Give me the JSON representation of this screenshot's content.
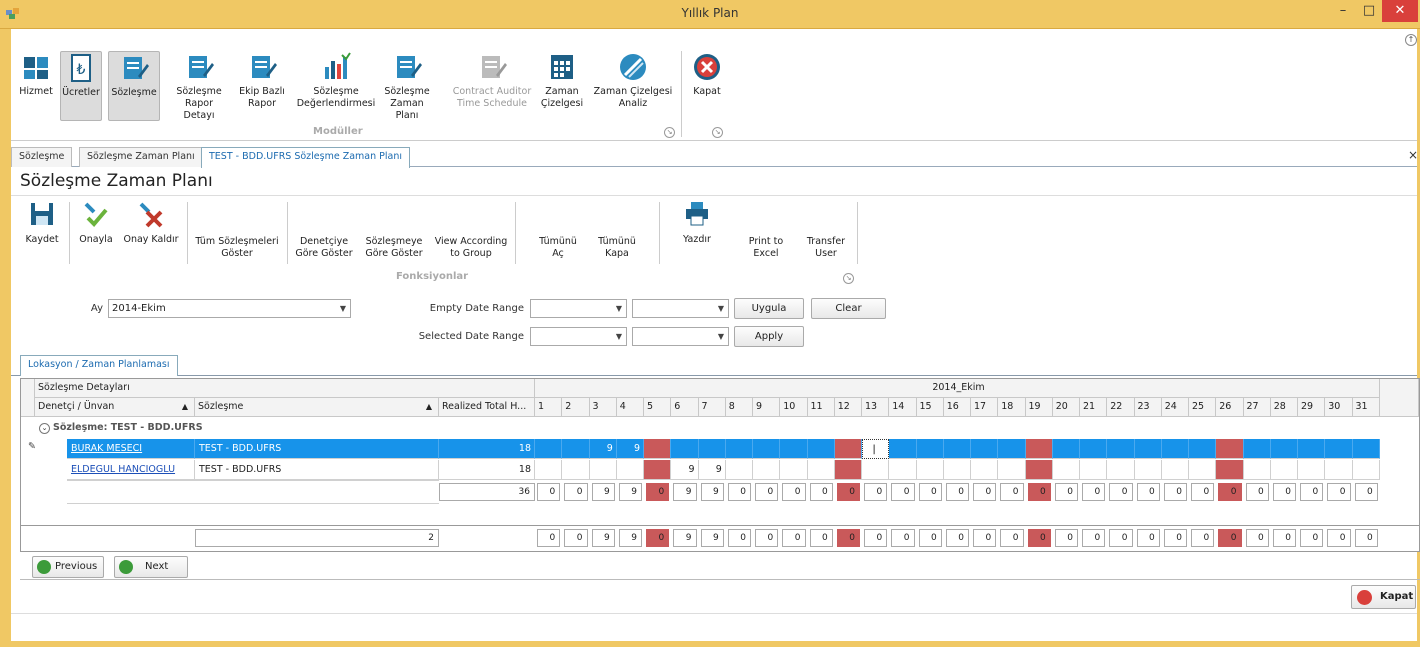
{
  "window": {
    "title": "Yıllık Plan",
    "min": "–",
    "max": "□",
    "close": "✕"
  },
  "ribbon": {
    "items": [
      "Hizmet",
      "Ücretler",
      "Sözleşme",
      "Sözleşme\nRapor Detayı",
      "Ekip Bazlı\nRapor",
      "Sözleşme\nDeğerlendirmesi",
      "Sözleşme\nZaman Planı",
      "Contract Auditor\nTime Schedule",
      "Zaman\nÇizelgesi",
      "Zaman Çizelgesi\nAnaliz",
      "Kapat"
    ],
    "group_label": "Modüller"
  },
  "doc_tabs": [
    "Sözleşme",
    "Sözleşme Zaman Planı",
    "TEST - BDD.UFRS Sözleşme Zaman Planı"
  ],
  "page_title": "Sözleşme Zaman Planı",
  "functions": {
    "items": [
      "Kaydet",
      "Onayla",
      "Onay Kaldır",
      "Tüm Sözleşmeleri\nGöster",
      "Denetçiye\nGöre Göster",
      "Sözleşmeye\nGöre Göster",
      "View According\nto Group",
      "Tümünü Aç",
      "Tümünü\nKapa",
      "Yazdır",
      "Print to\nExcel",
      "Transfer\nUser"
    ],
    "group_label": "Fonksiyonlar"
  },
  "filters": {
    "ay_label": "Ay",
    "ay_value": "2014-Ekim",
    "empty_label": "Empty Date Range",
    "selected_label": "Selected Date Range",
    "uygula": "Uygula",
    "clear": "Clear",
    "apply": "Apply"
  },
  "sub_tab": "Lokasyon / Zaman Planlaması",
  "grid": {
    "band_left": "Sözleşme Detayları",
    "band_right": "2014_Ekim",
    "col_auditor": "Denetçi / Ünvan",
    "col_contract": "Sözleşme",
    "col_total": "Realized Total H...",
    "days": [
      "1",
      "2",
      "3",
      "4",
      "5",
      "6",
      "7",
      "8",
      "9",
      "10",
      "11",
      "12",
      "13",
      "14",
      "15",
      "16",
      "17",
      "18",
      "19",
      "20",
      "21",
      "22",
      "23",
      "24",
      "25",
      "26",
      "27",
      "28",
      "29",
      "30",
      "31"
    ],
    "weekend_days": [
      5,
      12,
      19,
      26
    ],
    "group_row": "Sözleşme: TEST - BDD.UFRS",
    "rows": [
      {
        "auditor": "BURAK MESECI",
        "contract": "TEST - BDD.UFRS",
        "total": "18",
        "hours": {
          "3": "9",
          "4": "9"
        },
        "selected": true
      },
      {
        "auditor": "ELDEGUL HANCIOGLU",
        "contract": "TEST - BDD.UFRS",
        "total": "18",
        "hours": {
          "6": "9",
          "7": "9"
        },
        "selected": false
      }
    ],
    "group_total": "36",
    "group_day_totals": [
      "0",
      "0",
      "9",
      "9",
      "0",
      "9",
      "9",
      "0",
      "0",
      "0",
      "0",
      "0",
      "0",
      "0",
      "0",
      "0",
      "0",
      "0",
      "0",
      "0",
      "0",
      "0",
      "0",
      "0",
      "0",
      "0",
      "0",
      "0",
      "0",
      "0",
      "0"
    ],
    "grand_count": "2",
    "grand_day_totals": [
      "0",
      "0",
      "9",
      "9",
      "0",
      "9",
      "9",
      "0",
      "0",
      "0",
      "0",
      "0",
      "0",
      "0",
      "0",
      "0",
      "0",
      "0",
      "0",
      "0",
      "0",
      "0",
      "0",
      "0",
      "0",
      "0",
      "0",
      "0",
      "0",
      "0",
      "0"
    ]
  },
  "nav": {
    "previous": "Previous",
    "next": "Next"
  },
  "close_button": "Kapat",
  "colors": {
    "selection": "#1793ea",
    "weekend": "#c9595a",
    "frame": "#f0c864"
  }
}
